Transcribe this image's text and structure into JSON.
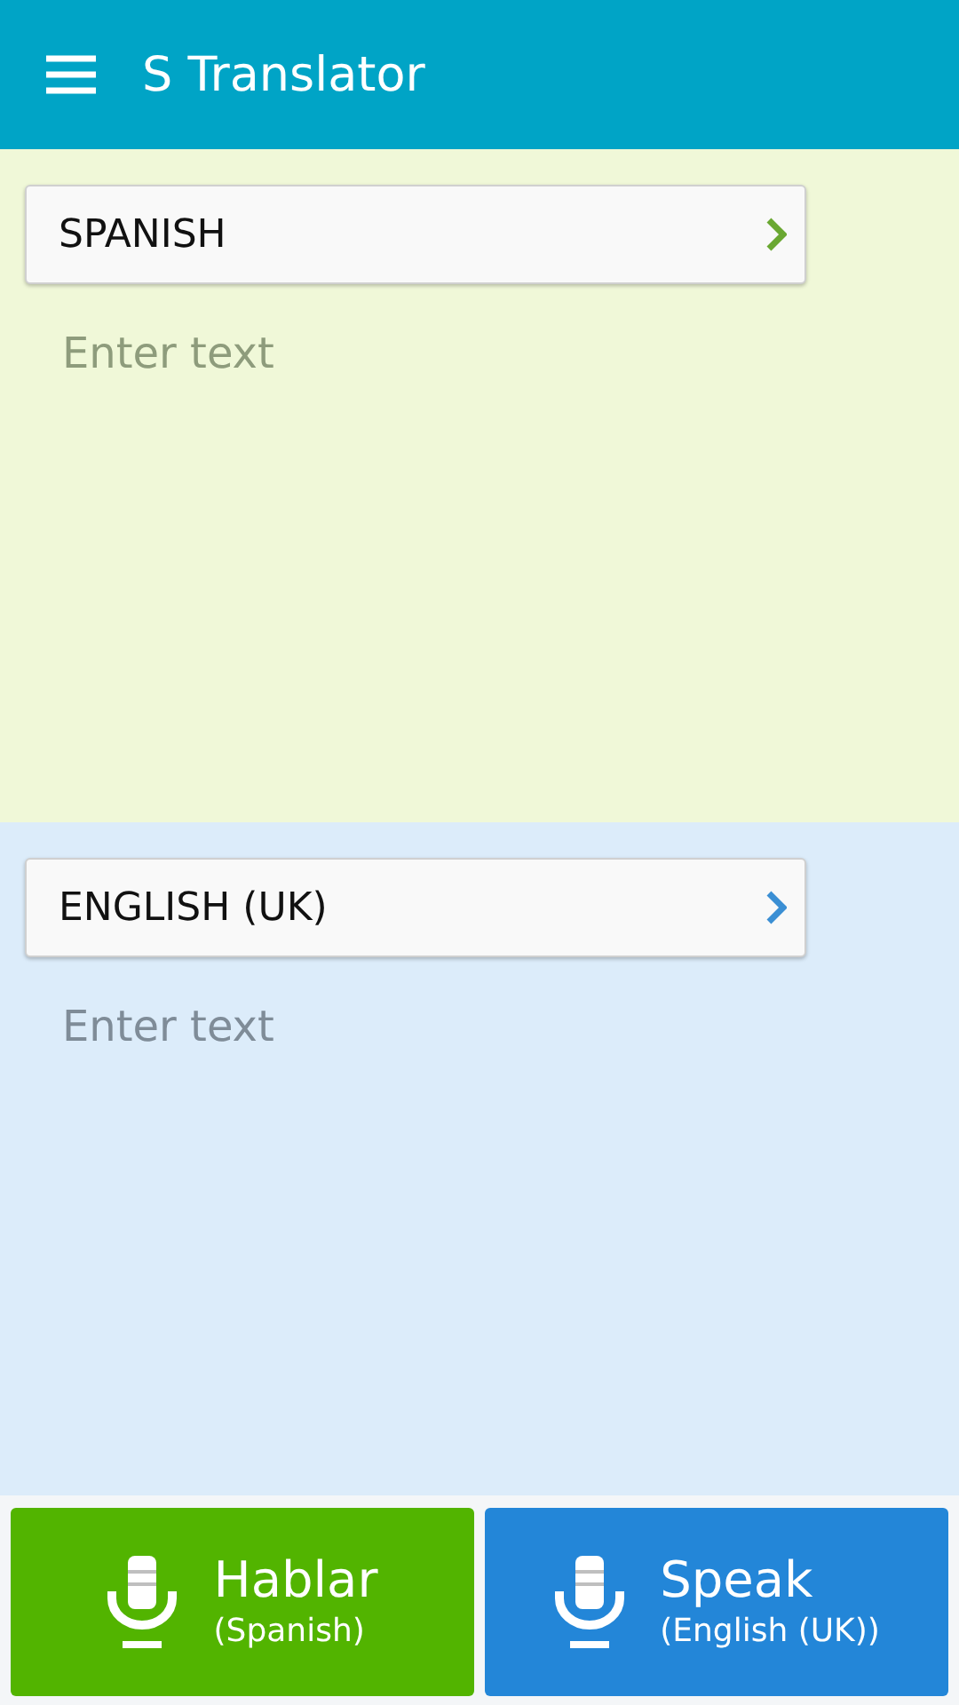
{
  "app_bar": {
    "title": "S Translator"
  },
  "panels": [
    {
      "kind": "source",
      "language": "SPANISH",
      "placeholder": "Enter text"
    },
    {
      "kind": "target",
      "language": "ENGLISH (UK)",
      "placeholder": "Enter text"
    }
  ],
  "speak_buttons": [
    {
      "kind": "source",
      "label": "Hablar",
      "sublabel": "(Spanish)"
    },
    {
      "kind": "target",
      "label": "Speak",
      "sublabel": "(English (UK))"
    }
  ]
}
